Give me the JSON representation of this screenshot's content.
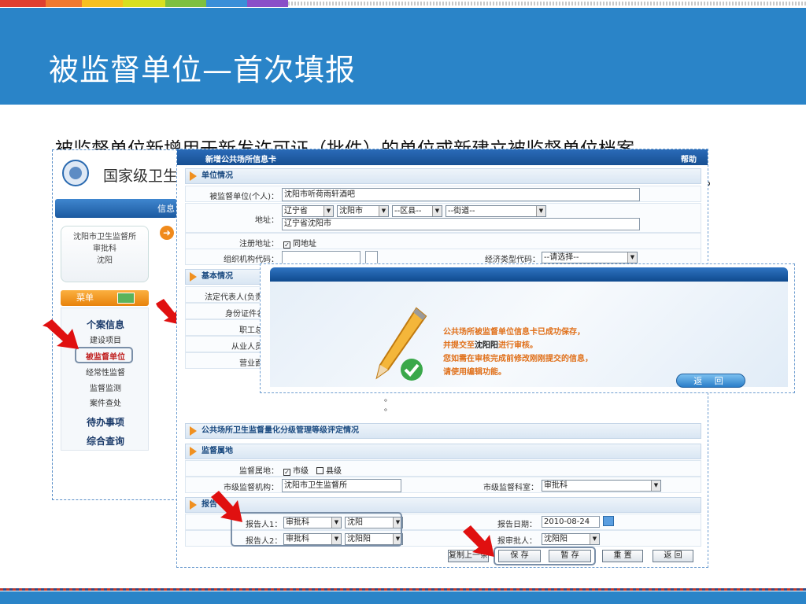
{
  "slide": {
    "title": "被监督单位—首次填报",
    "intro": "被监督单位新增用于新发许可证（批件）的单位或新建立被监督单位档案",
    "intro_tail": "。"
  },
  "colors": {
    "header": "#2a84c8",
    "stripes": [
      "#e04030",
      "#f07a30",
      "#f7c020",
      "#d8e020",
      "#7ec040",
      "#3a8fd8",
      "#2f4fb8",
      "#8a4fc8",
      "#c0c0c0",
      "#d8d8d8"
    ]
  },
  "bg_app": {
    "org_name": "国家级卫生",
    "nav_text": "信息",
    "unit_lines": [
      "沈阳市卫生监督所",
      "审批科",
      "沈阳"
    ],
    "menu_title": "菜单",
    "menu_items": [
      "个案信息",
      "建设项目",
      "被监督单位",
      "经常性监督",
      "监督监测",
      "案件查处",
      "待办事项",
      "综合查询"
    ]
  },
  "form": {
    "title": "新增公共场所信息卡",
    "help": "帮助",
    "sections": {
      "unit": "单位情况",
      "basic": "基本情况",
      "grade": "公共场所卫生监督量化分级管理等级评定情况",
      "jurisdiction": "监督属地",
      "report": "报告"
    },
    "fields": {
      "unit_name_label": "被监督单位(个人)：",
      "unit_name_value": "沈阳市听荷雨轩酒吧",
      "address_label": "地址：",
      "province": "辽宁省",
      "city": "沈阳市",
      "district": "--区县--",
      "street": "--街道--",
      "address_value": "辽宁省沈阳市",
      "reg_addr_label": "注册地址：",
      "reg_addr_check": "同地址",
      "org_code_label": "组织机构代码：",
      "econ_label": "经济类型代码：",
      "econ_value": "--请选择--",
      "legal_label": "法定代表人(负责",
      "id_label": "身份证件名",
      "staff_label": "职工总",
      "workers_label": "从业人员",
      "area_label": "营业面",
      "juris_label": "监督属地：",
      "juris_city": "市级",
      "juris_county": "县级",
      "city_org_label": "市级监督机构：",
      "city_org_value": "沈阳市卫生监督所",
      "city_dept_label": "市级监督科室：",
      "city_dept_value": "审批科",
      "reporter1_label": "报告人1：",
      "reporter1_dept": "审批科",
      "reporter1_city": "沈阳",
      "reporter2_label": "报告人2：",
      "reporter2_dept": "审批科",
      "reporter2_city": "沈阳阳",
      "date_label": "报告日期：",
      "date_value": "2010-08-24",
      "approver_label": "报审批人：",
      "approver_value": "沈阳阳"
    },
    "buttons": {
      "copy": "复制上一条",
      "save": "保 存",
      "temp": "暂 存",
      "reset": "重 置",
      "back": "返 回"
    }
  },
  "dialog": {
    "line1": "公共场所被监督单位信息卡已成功保存，",
    "line2_a": "并提交至",
    "line2_b": "沈阳阳",
    "line2_c": "进行审核。",
    "line3": "您如需在审核完成前修改刚刚提交的信息，",
    "line4": "请使用编辑功能。",
    "back": "返 回"
  },
  "dots": [
    "。",
    "。"
  ]
}
